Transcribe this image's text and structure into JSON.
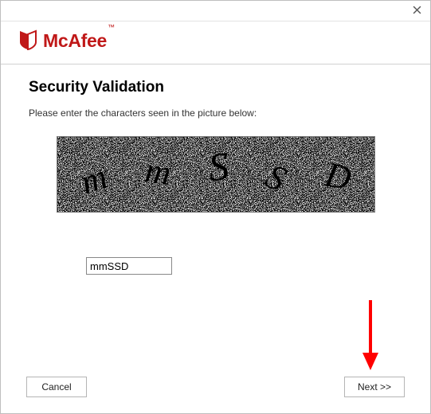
{
  "brand": {
    "name": "McAfee",
    "trademark": "™"
  },
  "header": {
    "title": "Security Validation"
  },
  "body": {
    "instruction": "Please enter the characters seen in the picture below:",
    "captcha_chars": [
      "m",
      "m",
      "S",
      "S",
      "D"
    ]
  },
  "form": {
    "captcha_input_value": "mmSSD"
  },
  "buttons": {
    "cancel": "Cancel",
    "next": "Next >>"
  },
  "icons": {
    "close": "close-icon",
    "logo": "mcafee-shield-icon"
  }
}
